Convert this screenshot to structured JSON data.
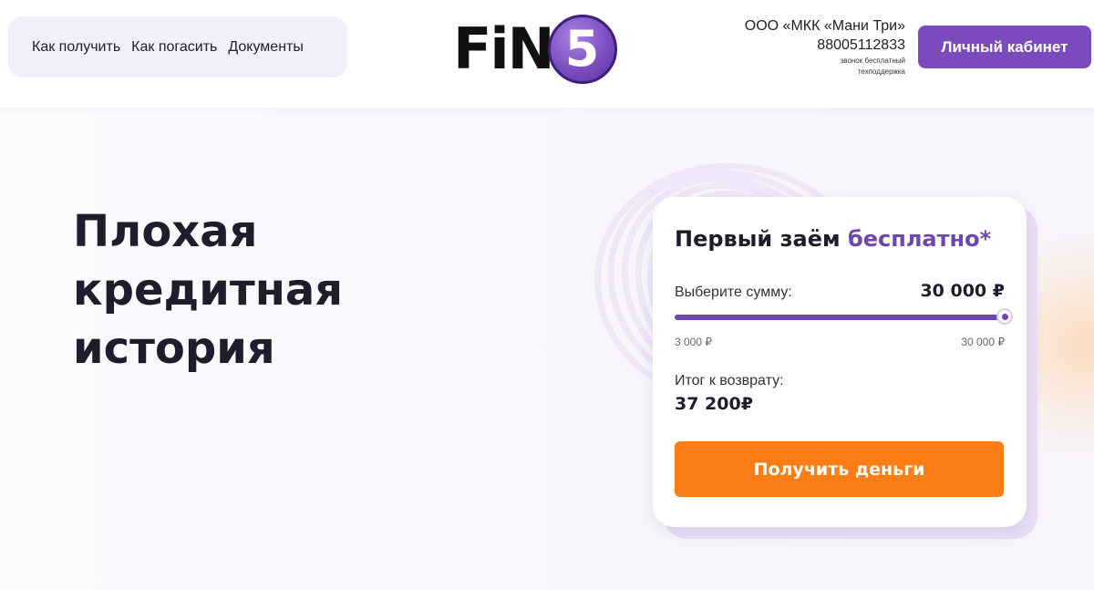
{
  "nav": {
    "items": [
      {
        "label": "Как получить"
      },
      {
        "label": "Как погасить"
      },
      {
        "label": "Документы"
      }
    ]
  },
  "logo": {
    "text": "FiN",
    "digit": "5"
  },
  "company": {
    "name": "ООО «МКК «Мани Три»",
    "phone": "88005112833",
    "note_line1": "звонок бесплатный",
    "note_line2": "техподдержка"
  },
  "header": {
    "cabinet_label": "Личный кабинет"
  },
  "hero": {
    "title_line1": "Плохая",
    "title_line2": "кредитная",
    "title_line3": "история"
  },
  "calculator": {
    "title": "Первый заём",
    "title_accent": "бесплатно*",
    "sum_label": "Выберите сумму:",
    "sum_value": "30 000 ₽",
    "slider_min_label": "3 000 ₽",
    "slider_max_label": "30 000 ₽",
    "slider_min": 3000,
    "slider_max": 30000,
    "slider_value": 30000,
    "total_label": "Итог к возврату:",
    "total_value": "37 200₽",
    "submit_label": "Получить деньги"
  },
  "colors": {
    "brand_purple": "#6f45b0",
    "button_purple": "#7b4bbd",
    "cta_orange": "#fb7d14",
    "nav_bg": "#f3eefc"
  }
}
